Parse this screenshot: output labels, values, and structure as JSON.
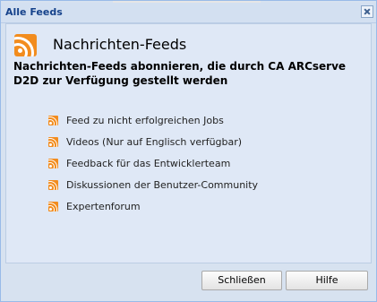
{
  "window": {
    "title": "Alle Feeds",
    "close_icon": "close-icon"
  },
  "content": {
    "heading": "Nachrichten-Feeds",
    "heading_icon": "rss-icon",
    "subheading": "Nachrichten-Feeds abonnieren, die durch CA ARCserve D2D zur Verfügung gestellt werden",
    "links": [
      {
        "label": "Feed zu nicht erfolgreichen Jobs",
        "icon": "rss-icon"
      },
      {
        "label": "Videos (Nur auf Englisch verfügbar)",
        "icon": "rss-icon"
      },
      {
        "label": "Feedback für das Entwicklerteam",
        "icon": "rss-icon"
      },
      {
        "label": "Diskussionen der Benutzer-Community",
        "icon": "rss-icon"
      },
      {
        "label": "Expertenforum",
        "icon": "rss-icon"
      }
    ]
  },
  "footer": {
    "close_label": "Schließen",
    "help_label": "Hilfe"
  },
  "colors": {
    "title_text": "#15428b",
    "rss_orange": "#f28c1e",
    "panel_bg": "#dfe8f6",
    "window_border": "#99bbe8"
  }
}
